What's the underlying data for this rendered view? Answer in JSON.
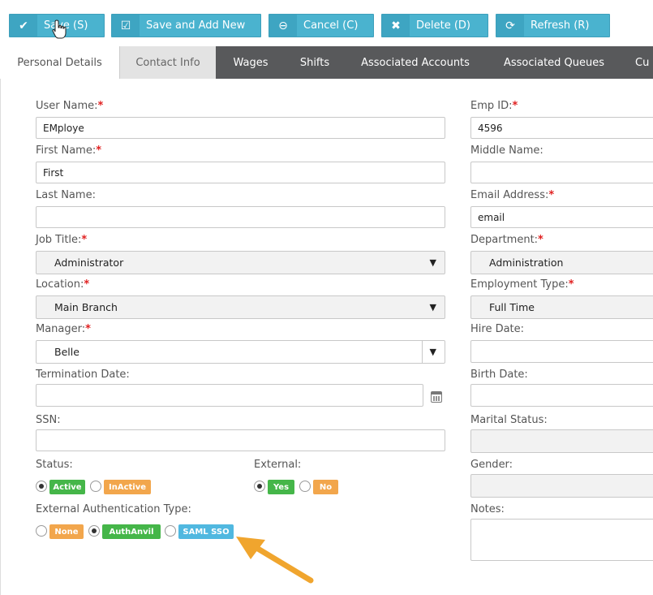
{
  "toolbar": {
    "save_label": "Save (S)",
    "save_add_label": "Save and Add New",
    "cancel_label": "Cancel (C)",
    "delete_label": "Delete (D)",
    "refresh_label": "Refresh (R)"
  },
  "tabs": [
    "Personal Details",
    "Contact Info",
    "Wages",
    "Shifts",
    "Associated Accounts",
    "Associated Queues",
    "Cu"
  ],
  "form": {
    "user_name": {
      "label": "User Name:",
      "value": "EMploye"
    },
    "first_name": {
      "label": "First Name:",
      "value": "First"
    },
    "last_name": {
      "label": "Last Name:",
      "value": ""
    },
    "job_title": {
      "label": "Job Title:",
      "value": "Administrator"
    },
    "location": {
      "label": "Location:",
      "value": "Main Branch"
    },
    "manager": {
      "label": "Manager:",
      "value": "Belle"
    },
    "termination_date": {
      "label": "Termination Date:",
      "value": ""
    },
    "ssn": {
      "label": "SSN:",
      "value": ""
    },
    "status": {
      "label": "Status:",
      "options": [
        "Active",
        "InActive"
      ],
      "selected": "Active"
    },
    "external": {
      "label": "External:",
      "options": [
        "Yes",
        "No"
      ],
      "selected": "Yes"
    },
    "ext_auth": {
      "label": "External Authentication Type:",
      "options": [
        "None",
        "AuthAnvil",
        "SAML SSO"
      ],
      "selected": "AuthAnvil"
    },
    "emp_id": {
      "label": "Emp ID:",
      "value": "4596"
    },
    "middle_name": {
      "label": "Middle Name:",
      "value": ""
    },
    "email": {
      "label": "Email Address:",
      "value": "email"
    },
    "department": {
      "label": "Department:",
      "value": "Administration"
    },
    "employment_type": {
      "label": "Employment Type:",
      "value": "Full Time"
    },
    "hire_date": {
      "label": "Hire Date:",
      "value": ""
    },
    "birth_date": {
      "label": "Birth Date:",
      "value": ""
    },
    "marital_status": {
      "label": "Marital Status:",
      "value": ""
    },
    "gender": {
      "label": "Gender:",
      "value": ""
    },
    "notes": {
      "label": "Notes:",
      "value": ""
    }
  },
  "required_marker": "*",
  "colors": {
    "toolbar_button": "#4ab3cf",
    "tab_bar": "#58595b",
    "badge_green": "#45b649",
    "badge_orange": "#f2a64c",
    "badge_blue": "#50b8e0",
    "arrow": "#f0a52e",
    "required": "#e02020"
  },
  "icons": [
    "check-icon",
    "edit-square-icon",
    "minus-circle-icon",
    "close-icon",
    "refresh-icon",
    "chevron-down-icon",
    "calendar-icon",
    "mouse-cursor-icon",
    "annotation-arrow"
  ]
}
